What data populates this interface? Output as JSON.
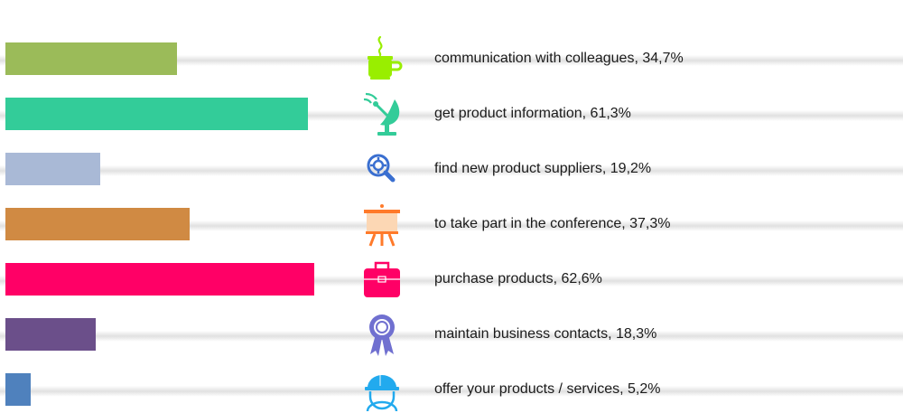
{
  "chart_data": {
    "type": "bar",
    "orientation": "horizontal",
    "xlim": [
      0,
      100
    ],
    "categories": [
      "communication with colleagues",
      "get product information",
      "find new product suppliers",
      "to take part in the conference",
      "purchase products",
      "maintain business contacts",
      "offer your products / services"
    ],
    "values": [
      34.7,
      61.3,
      19.2,
      37.3,
      62.6,
      18.3,
      5.2
    ],
    "labels": [
      "communication with colleagues, 34,7%",
      "get product information, 61,3%",
      "find new product suppliers, 19,2%",
      "to take part in the conference, 37,3%",
      "purchase products, 62,6%",
      "maintain business contacts, 18,3%",
      "offer your products / services, 5,2%"
    ],
    "colors": [
      "#9bbb59",
      "#33cc99",
      "#a9b9d6",
      "#d08a43",
      "#ff0066",
      "#6b4f8a",
      "#4f81bd"
    ],
    "icons": [
      "coffee-cup-icon",
      "satellite-dish-icon",
      "magnifier-gear-icon",
      "presentation-easel-icon",
      "briefcase-icon",
      "award-ribbon-icon",
      "hard-hat-worker-icon"
    ],
    "icon_colors": [
      "#99ee00",
      "#33cc99",
      "#3a6fd0",
      "#ff7a2a",
      "#ff0066",
      "#7070d0",
      "#22aaee"
    ]
  }
}
